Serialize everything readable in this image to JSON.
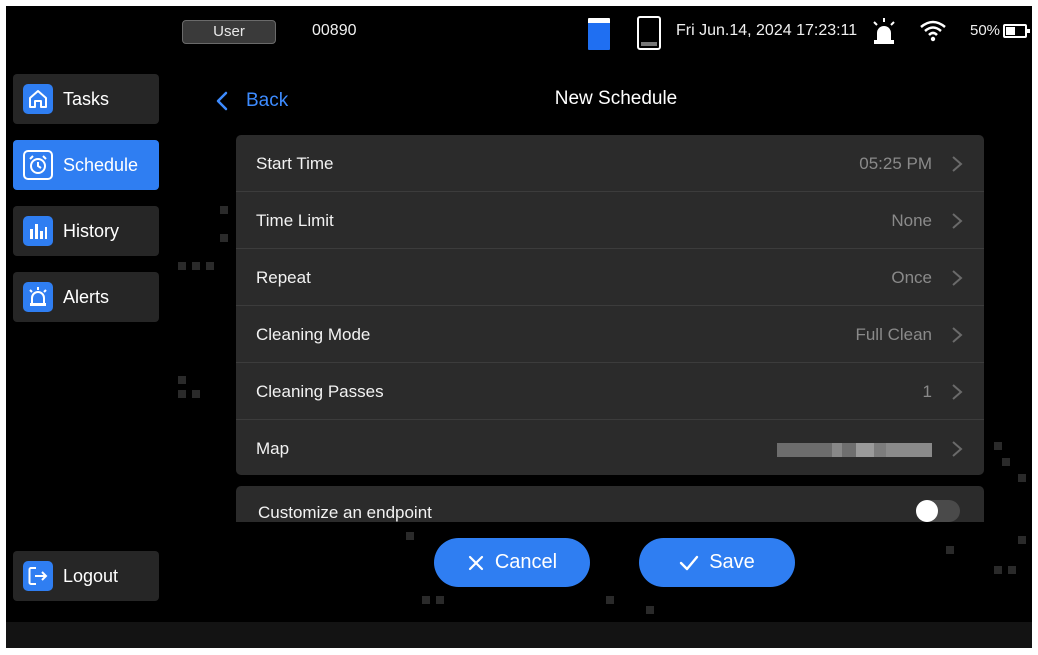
{
  "status_bar": {
    "user_label": "User",
    "device_id": "00890",
    "datetime": "Fri Jun.14, 2024 17:23:11",
    "battery_percent": "50%",
    "icons": [
      "water-tank-full-icon",
      "water-tank-empty-icon",
      "alarm-icon",
      "wifi-icon",
      "battery-icon"
    ]
  },
  "sidebar": {
    "items": [
      {
        "label": "Tasks",
        "icon": "home-icon",
        "active": false
      },
      {
        "label": "Schedule",
        "icon": "clock-icon",
        "active": true
      },
      {
        "label": "History",
        "icon": "bar-chart-icon",
        "active": false
      },
      {
        "label": "Alerts",
        "icon": "alarm-icon",
        "active": false
      }
    ],
    "logout_label": "Logout"
  },
  "header": {
    "back_label": "Back",
    "title": "New Schedule"
  },
  "settings": {
    "rows": [
      {
        "label": "Start Time",
        "value": "05:25 PM"
      },
      {
        "label": "Time Limit",
        "value": "None"
      },
      {
        "label": "Repeat",
        "value": "Once"
      },
      {
        "label": "Cleaning Mode",
        "value": "Full Clean"
      },
      {
        "label": "Cleaning Passes",
        "value": "1"
      },
      {
        "label": "Map",
        "value": ""
      }
    ],
    "endpoint_label": "Customize an endpoint",
    "endpoint_enabled": false
  },
  "actions": {
    "cancel_label": "Cancel",
    "save_label": "Save"
  },
  "colors": {
    "accent": "#2f7ef2",
    "link": "#3d8bff",
    "background": "#000000",
    "panel": "#2b2b2b"
  }
}
